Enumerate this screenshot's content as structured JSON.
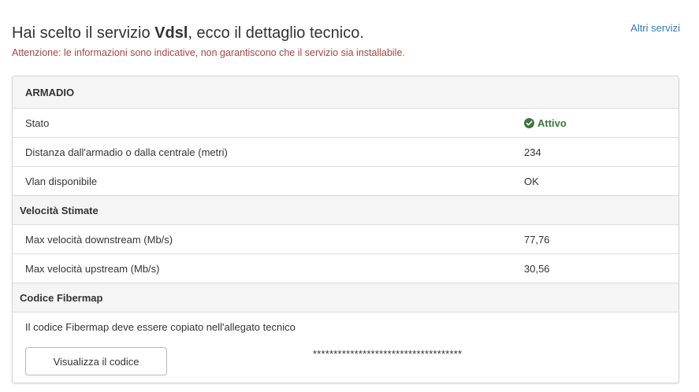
{
  "header": {
    "title_prefix": "Hai scelto il servizio ",
    "service_name": "Vdsl",
    "title_suffix": ", ecco il dettaglio tecnico.",
    "warning": "Attenzione: le informazioni sono indicative, non garantiscono che il servizio sia installabile.",
    "other_services_link": "Altri servizi"
  },
  "panel": {
    "heading": "ARMADIO",
    "rows": [
      {
        "label": "Stato",
        "value": "Attivo",
        "status": true
      },
      {
        "label": "Distanza dall'armadio o dalla centrale (metri)",
        "value": "234"
      },
      {
        "label": "Vlan disponibile",
        "value": "OK"
      }
    ],
    "speed_section": {
      "title": "Velocità Stimate",
      "rows": [
        {
          "label": "Max velocità downstream (Mb/s)",
          "value": "77,76"
        },
        {
          "label": "Max velocità upstream (Mb/s)",
          "value": "30,56"
        }
      ]
    },
    "fibermap_section": {
      "title": "Codice Fibermap",
      "description": "Il codice Fibermap deve essere copiato nell'allegato tecnico",
      "button_label": "Visualizza il codice",
      "masked_code": "************************************"
    }
  },
  "colors": {
    "warning": "#a94442",
    "link": "#337ab7",
    "status_active": "#3c763d",
    "section_bg": "#f5f5f5",
    "border": "#dddddd"
  },
  "icons": {
    "status": "check-circle-icon"
  }
}
